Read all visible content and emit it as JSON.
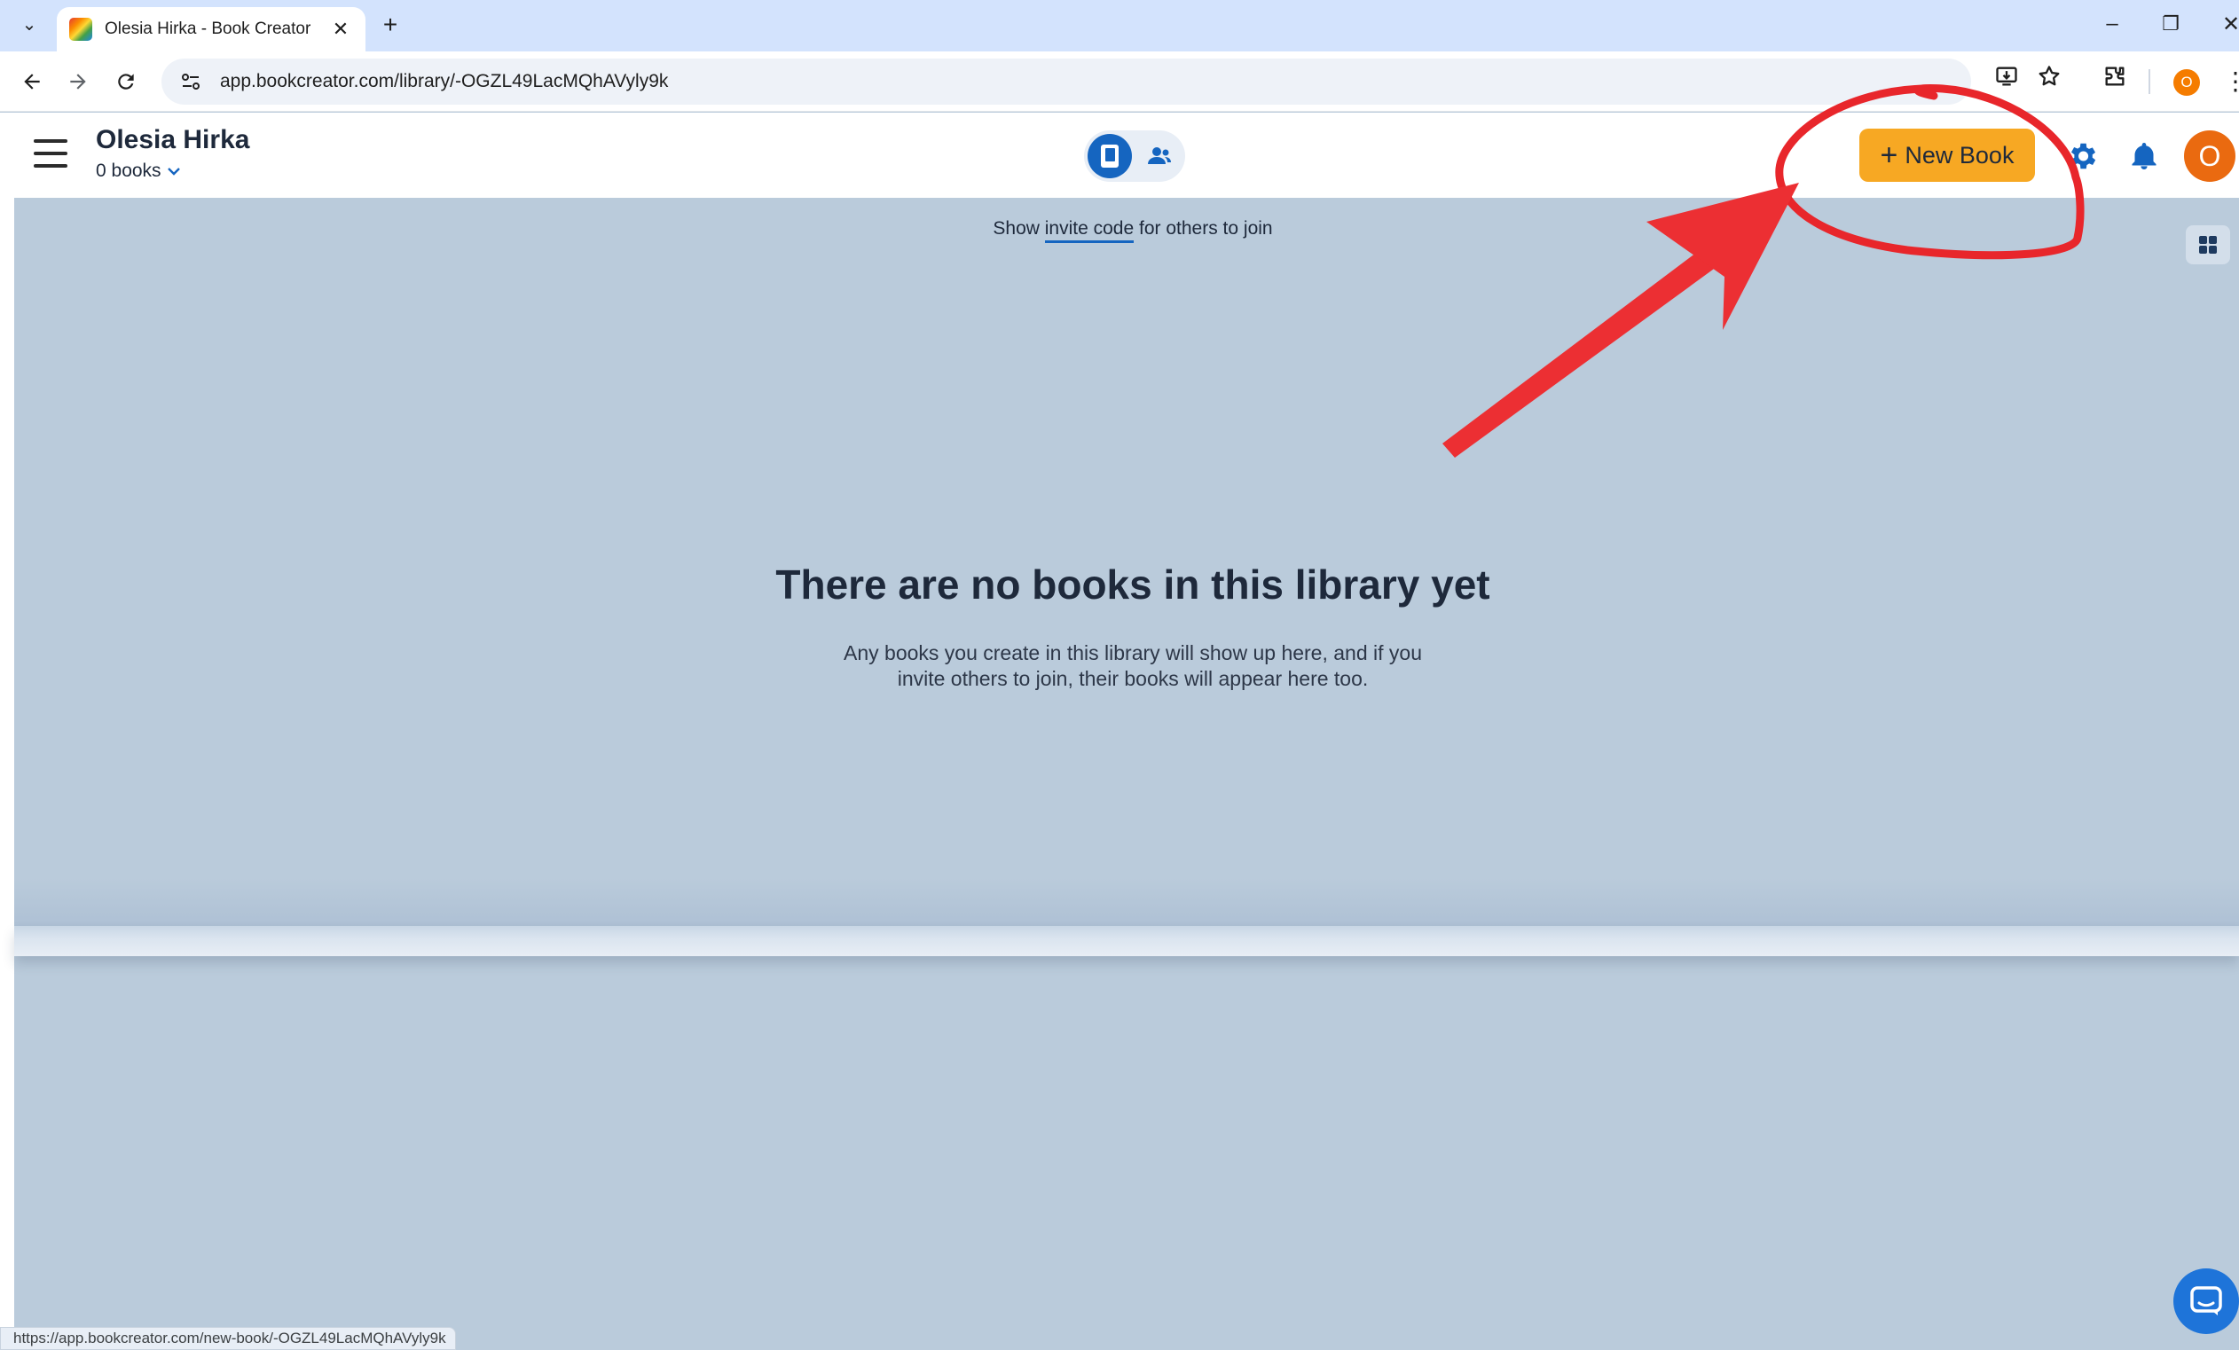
{
  "browser": {
    "tab_title": "Olesia Hirka - Book Creator",
    "tab_close": "✕",
    "new_tab": "+",
    "tab_menu": "⌄",
    "window_controls": {
      "minimize": "–",
      "restore": "❐",
      "close": "✕"
    },
    "url": "app.bookcreator.com/library/-OGZL49LacMQhAVyly9k",
    "profile_initial": "O",
    "status_url": "https://app.bookcreator.com/new-book/-OGZL49LacMQhAVyly9k"
  },
  "header": {
    "library_name": "Olesia Hirka",
    "book_count": "0 books",
    "new_book_plus": "+",
    "new_book_label": "New Book",
    "avatar_initial": "O"
  },
  "main": {
    "invite_prefix": "Show",
    "invite_link": "invite code",
    "invite_suffix": "for others to join",
    "empty_title": "There are no books in this library yet",
    "empty_desc_line1": "Any books you create in this library will show up here, and if you",
    "empty_desc_line2": "invite others to join, their books will appear here too."
  },
  "colors": {
    "accent_blue": "#1565c0",
    "new_book_orange": "#f7a823",
    "avatar_orange": "#ea6a10",
    "page_bg": "#bacbdb",
    "annotation_red": "#e8262b"
  },
  "icons": [
    "menu-icon",
    "book-icon",
    "people-icon",
    "gear-icon",
    "bell-icon",
    "grid-icon",
    "chat-icon",
    "back-arrow-icon",
    "forward-arrow-icon",
    "reload-icon",
    "install-icon",
    "star-icon",
    "extensions-icon"
  ]
}
